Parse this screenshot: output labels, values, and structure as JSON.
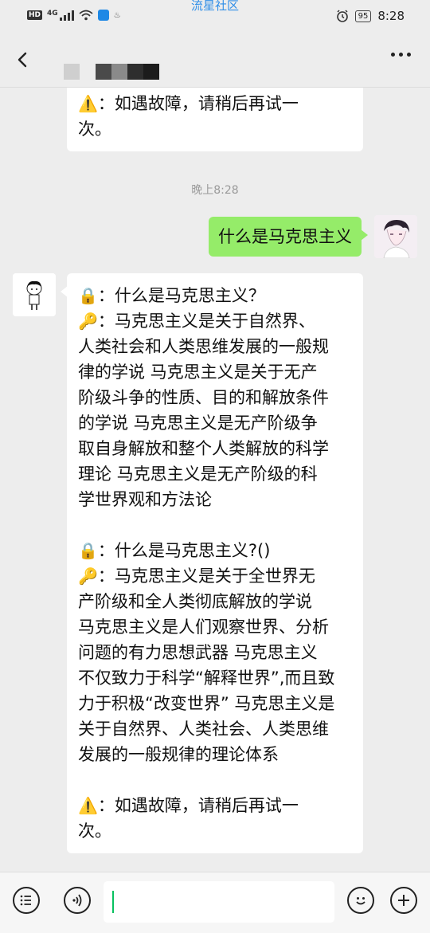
{
  "status_bar": {
    "network_badge": "HD",
    "network_type": "4G",
    "center_label": "流星社区",
    "battery": "95",
    "time": "8:28"
  },
  "header": {
    "back_icon": "chevron-left-icon",
    "more_icon": "more-dots-icon"
  },
  "messages": {
    "top_partial": {
      "icon": "⚠️",
      "text": "：如遇故障，请稍后再试一\n次。"
    },
    "timestamp": "晚上8:28",
    "user_message": "什么是马克思主义",
    "bot_reply": {
      "q1_icon": "🔒",
      "q1_text": "：什么是马克思主义？",
      "a1_icon": "🔑",
      "a1_text": "：马克思主义是关于自然界、\n人类社会和人类思维发展的一般规\n律的学说 马克思主义是关于无产\n阶级斗争的性质、目的和解放条件\n的学说 马克思主义是无产阶级争\n取自身解放和整个人类解放的科学\n理论 马克思主义是无产阶级的科\n学世界观和方法论",
      "q2_icon": "🔒",
      "q2_text": "：什么是马克思主义?()",
      "a2_icon": "🔑",
      "a2_text": "：马克思主义是关于全世界无\n产阶级和全人类彻底解放的学说\n马克思主义是人们观察世界、分析\n问题的有力思想武器 马克思主义\n不仅致力于科学“解释世界”,而且致\n力于积极“改变世界” 马克思主义是\n关于自然界、人类社会、人类思维\n发展的一般规律的理论体系",
      "warn_icon": "⚠️",
      "warn_text": "：如遇故障，请稍后再试一\n次。"
    }
  },
  "input_bar": {
    "menu_icon": "menu-list-icon",
    "voice_icon": "voice-icon",
    "emoji_icon": "emoji-icon",
    "plus_icon": "plus-icon",
    "input_value": ""
  },
  "colors": {
    "background": "#ededed",
    "user_bubble": "#95ec69",
    "bot_bubble": "#ffffff",
    "accent_title": "#2f8ee8",
    "caret": "#07c160"
  }
}
